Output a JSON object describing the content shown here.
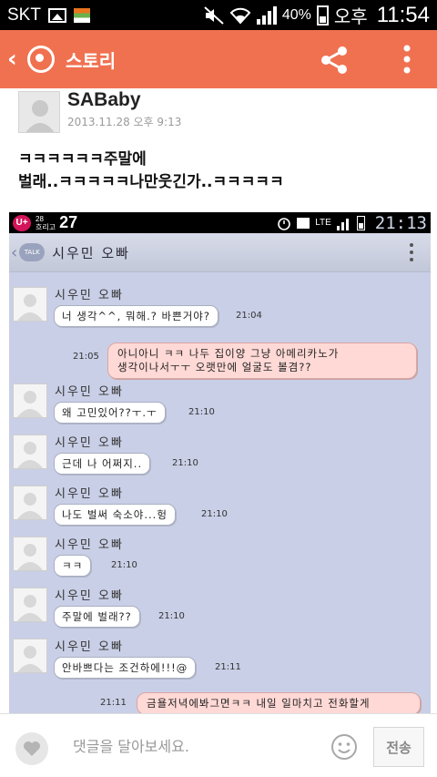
{
  "status_bar": {
    "carrier": "SKT",
    "battery": "40%",
    "ampm": "오후",
    "time": "11:54"
  },
  "app_bar": {
    "title": "스토리"
  },
  "post": {
    "author": "SABaby",
    "date": "2013.11.28 오후 9:13",
    "text": "ㅋㅋㅋㅋㅋㅋ주말에\n벌래..ㅋㅋㅋㅋㅋ나만웃긴가..ㅋㅋㅋㅋㅋ"
  },
  "embedded": {
    "status": {
      "carrier_logo": "U+",
      "weather_line1": "28",
      "weather_line2": "흐리고",
      "temperature": "27",
      "network": "LTE",
      "time": "21:13"
    },
    "header": {
      "badge": "TALK",
      "title": "시우민 오빠"
    },
    "messages": [
      {
        "name": "시우민 오빠",
        "text": "너 생각^^, 뭐해.? 바쁜거야?",
        "time": "21:04"
      },
      {
        "name": "시우민 오빠",
        "text": "왜 고민있어??ㅜ.ㅜ",
        "time": "21:10"
      },
      {
        "name": "시우민 오빠",
        "text": "근데 나 어쩌지..",
        "time": "21:10"
      },
      {
        "name": "시우민 오빠",
        "text": "나도 벌써 숙소야...헝",
        "time": "21:10"
      },
      {
        "name": "시우민 오빠",
        "text": "ㅋㅋ",
        "time": "21:10"
      },
      {
        "name": "시우민 오빠",
        "text": "주말에 벌래??",
        "time": "21:10"
      },
      {
        "name": "시우민 오빠",
        "text": "안바쁘다는 조건하에!!!@",
        "time": "21:11"
      }
    ],
    "outgoing": [
      {
        "text": "아니아니 ㅋㅋ 나두 집이양 그냥 아메리카노가\n생각이나서ㅜㅜ 오랫만에 얼굴도 볼겸??",
        "time": "21:05"
      },
      {
        "text": "금욜저녁에봐그면ㅋㅋ 내일 일마치고 전화할게",
        "time": "21:11"
      }
    ]
  },
  "comment_bar": {
    "placeholder": "댓글을 달아보세요.",
    "send_label": "전송"
  },
  "colors": {
    "app_bar": "#f07150",
    "chat_background": "#c9cfe6",
    "outgoing_bubble": "#ffd9d6"
  },
  "icons": [
    "back-chevron-icon",
    "story-logo-icon",
    "share-icon",
    "more-menu-icon",
    "heart-icon",
    "emoticon-icon"
  ]
}
